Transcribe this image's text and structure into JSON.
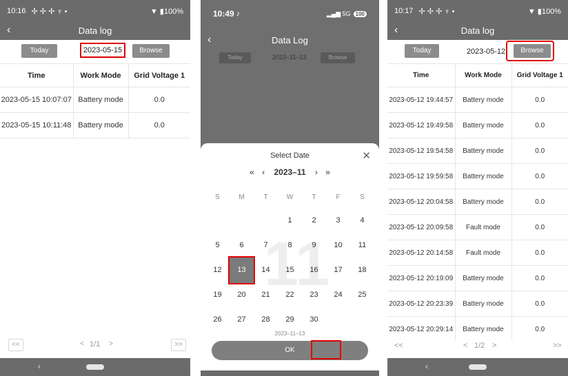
{
  "panel1": {
    "status": {
      "time": "10:16",
      "icons": "✢ ✢ ✢ ♆ •",
      "battery": "▼ ▮100%"
    },
    "nav": {
      "back": "‹",
      "title": "Data log"
    },
    "toolbar": {
      "today": "Today",
      "date": "2023-05-15",
      "browse": "Browse"
    },
    "columns": [
      "Time",
      "Work Mode",
      "Grid Voltage 1"
    ],
    "rows": [
      {
        "time": "2023-05-15 10:07:07",
        "mode": "Battery mode",
        "voltage": "0.0"
      },
      {
        "time": "2023-05-15 10:11:48",
        "mode": "Battery mode",
        "voltage": "0.0"
      }
    ],
    "pager": {
      "first": "<<",
      "prev": "<",
      "page": "1/1",
      "next": ">",
      "last": ">>"
    }
  },
  "panel2": {
    "status": {
      "time": "10:49",
      "icon": "♪",
      "signal": "5G",
      "battery": "100"
    },
    "nav": {
      "back": "‹",
      "title": "Data Log"
    },
    "toolbar": {
      "today": "Today",
      "date": "2023–11–13",
      "browse": "Browse"
    },
    "sheet": {
      "title": "Select Date",
      "close": "✕",
      "prev_year": "«",
      "prev_month": "‹",
      "month": "2023–11",
      "next_month": "›",
      "next_year": "»",
      "watermark": "11",
      "weekdays": [
        "S",
        "M",
        "T",
        "W",
        "T",
        "F",
        "S"
      ],
      "days": [
        "",
        "",
        "",
        "1",
        "2",
        "3",
        "4",
        "5",
        "6",
        "7",
        "8",
        "9",
        "10",
        "11",
        "12",
        "13",
        "14",
        "15",
        "16",
        "17",
        "18",
        "19",
        "20",
        "21",
        "22",
        "23",
        "24",
        "25",
        "26",
        "27",
        "28",
        "29",
        "30"
      ],
      "selected_day": "13",
      "selected_date": "2023–11–13",
      "ok": "OK"
    }
  },
  "panel3": {
    "status": {
      "time": "10:17",
      "icons": "✢ ✢ ✢ ♆ •",
      "battery": "▼ ▮100%"
    },
    "nav": {
      "back": "‹",
      "title": "Data log"
    },
    "toolbar": {
      "today": "Today",
      "date": "2023-05-12",
      "browse": "Browse"
    },
    "columns": [
      "Time",
      "Work Mode",
      "Grid Voltage 1"
    ],
    "rows": [
      {
        "time": "2023-05-12 19:44:57",
        "mode": "Battery mode",
        "voltage": "0.0"
      },
      {
        "time": "2023-05-12 19:49:58",
        "mode": "Battery mode",
        "voltage": "0.0"
      },
      {
        "time": "2023-05-12 19:54:58",
        "mode": "Battery mode",
        "voltage": "0.0"
      },
      {
        "time": "2023-05-12 19:59:58",
        "mode": "Battery mode",
        "voltage": "0.0"
      },
      {
        "time": "2023-05-12 20:04:58",
        "mode": "Battery mode",
        "voltage": "0.0"
      },
      {
        "time": "2023-05-12 20:09:58",
        "mode": "Fault mode",
        "voltage": "0.0"
      },
      {
        "time": "2023-05-12 20:14:58",
        "mode": "Fault mode",
        "voltage": "0.0"
      },
      {
        "time": "2023-05-12 20:19:09",
        "mode": "Battery mode",
        "voltage": "0.0"
      },
      {
        "time": "2023-05-12 20:23:39",
        "mode": "Battery mode",
        "voltage": "0.0"
      },
      {
        "time": "2023-05-12 20:29:14",
        "mode": "Battery mode",
        "voltage": "0.0"
      }
    ],
    "pager": {
      "first": "<<",
      "prev": "<",
      "page": "1/2",
      "next": ">",
      "last": ">>"
    }
  },
  "colors": {
    "bar": "#6b6b6b",
    "button": "#8c8c8c",
    "highlight": "#e00000"
  }
}
